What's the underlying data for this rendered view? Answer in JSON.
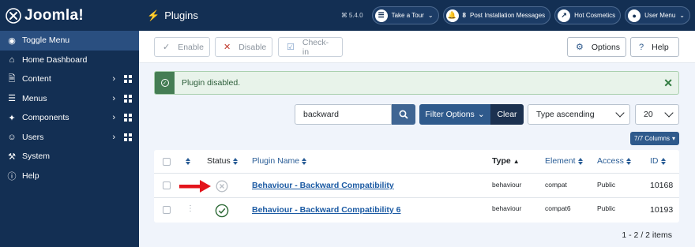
{
  "header": {
    "logo_text": "Joomla!",
    "page_title": "Plugins",
    "version": "5.4.0",
    "take_tour": "Take a Tour",
    "messages_count": "8",
    "messages_label": "Post Installation Messages",
    "site_label": "Hot Cosmetics",
    "user_menu": "User Menu"
  },
  "sidebar": {
    "items": [
      {
        "label": "Toggle Menu",
        "icon": "toggle-icon"
      },
      {
        "label": "Home Dashboard",
        "icon": "home-icon"
      },
      {
        "label": "Content",
        "icon": "file-icon"
      },
      {
        "label": "Menus",
        "icon": "list-icon"
      },
      {
        "label": "Components",
        "icon": "puzzle-icon"
      },
      {
        "label": "Users",
        "icon": "users-icon"
      },
      {
        "label": "System",
        "icon": "wrench-icon"
      },
      {
        "label": "Help",
        "icon": "info-icon"
      }
    ]
  },
  "toolbar": {
    "enable": "Enable",
    "disable": "Disable",
    "checkin": "Check-in",
    "options": "Options",
    "help": "Help"
  },
  "alert": {
    "message": "Plugin disabled."
  },
  "filters": {
    "search_value": "backward",
    "filter_options": "Filter Options",
    "clear": "Clear",
    "ordering": "Type ascending",
    "limit": "20",
    "columns": "7/7 Columns"
  },
  "table": {
    "headers": {
      "status": "Status",
      "name": "Plugin Name",
      "type": "Type",
      "element": "Element",
      "access": "Access",
      "id": "ID"
    },
    "rows": [
      {
        "name": "Behaviour - Backward Compatibility",
        "type": "behaviour",
        "element": "compat",
        "access": "Public",
        "id": "10168",
        "status": "disabled"
      },
      {
        "name": "Behaviour - Backward Compatibility 6",
        "type": "behaviour",
        "element": "compat6",
        "access": "Public",
        "id": "10193",
        "status": "enabled"
      }
    ]
  },
  "pagination": {
    "count": "1 - 2 / 2 items"
  },
  "colors": {
    "header_bg": "#132f53",
    "accent": "#2f5a8c",
    "success": "#457d54",
    "arrow": "#e3141b"
  }
}
